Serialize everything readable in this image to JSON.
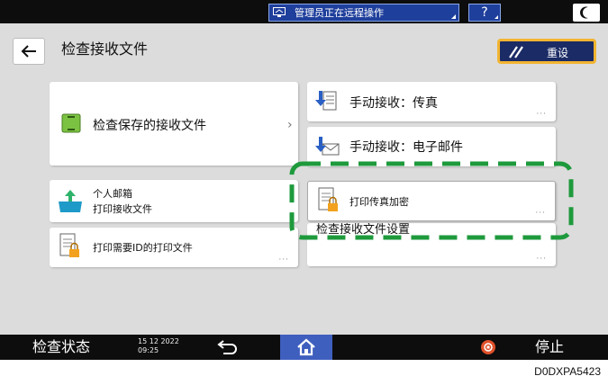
{
  "topbar": {
    "remote_text": "管理员正在远程操作",
    "help_label": "?"
  },
  "header": {
    "title": "检查接收文件",
    "reset_label": "重设"
  },
  "cards": {
    "saved_files": "检查保存的接收文件",
    "manual_fax": "手动接收：传真",
    "manual_email": "手动接收：电子邮件",
    "mailbox_line1": "个人邮箱",
    "mailbox_line2": "打印接收文件",
    "print_id": "打印需要ID的打印文件",
    "print_fax_encrypted": "打印传真加密",
    "receive_settings": "检查接收文件设置"
  },
  "bottombar": {
    "check_status": "检查状态",
    "date": "15 12 2022",
    "time": "09:25",
    "stop_label": "停止"
  },
  "image_code": "D0DXPA5423",
  "colors": {
    "highlight": "#1e9a3c",
    "reset_border": "#f2b532",
    "accent_blue": "#3f5fbf"
  }
}
